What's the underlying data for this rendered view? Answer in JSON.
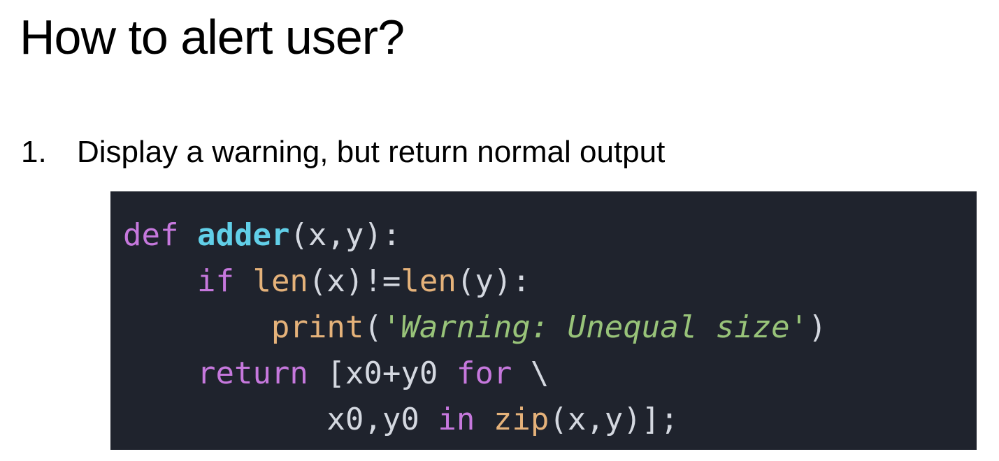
{
  "slide": {
    "title": "How to alert user?",
    "list": {
      "number": "1.",
      "text": "Display a warning, but return normal output"
    }
  },
  "code": {
    "language": "python",
    "colors": {
      "background": "#1f232d",
      "keyword": "#c678dd",
      "function_name": "#61cfe8",
      "builtin": "#e5b27a",
      "string": "#98c379",
      "plain": "#d4d8e0"
    },
    "lines": [
      {
        "indent": "",
        "tokens": [
          {
            "t": "def",
            "k": "kw"
          },
          {
            "t": " ",
            "k": "plain"
          },
          {
            "t": "adder",
            "k": "fn"
          },
          {
            "t": "(x,y):",
            "k": "plain"
          }
        ]
      },
      {
        "indent": "    ",
        "tokens": [
          {
            "t": "if",
            "k": "kw"
          },
          {
            "t": " ",
            "k": "plain"
          },
          {
            "t": "len",
            "k": "builtin"
          },
          {
            "t": "(x)!=",
            "k": "plain"
          },
          {
            "t": "len",
            "k": "builtin"
          },
          {
            "t": "(y):",
            "k": "plain"
          }
        ]
      },
      {
        "indent": "        ",
        "tokens": [
          {
            "t": "print",
            "k": "builtin"
          },
          {
            "t": "(",
            "k": "plain"
          },
          {
            "t": "'Warning: Unequal size'",
            "k": "str"
          },
          {
            "t": ")",
            "k": "plain"
          }
        ]
      },
      {
        "indent": "    ",
        "tokens": [
          {
            "t": "return",
            "k": "kw"
          },
          {
            "t": " [x0+y0 ",
            "k": "plain"
          },
          {
            "t": "for",
            "k": "kw"
          },
          {
            "t": " \\",
            "k": "plain"
          }
        ]
      },
      {
        "indent": "           ",
        "tokens": [
          {
            "t": "x0,y0 ",
            "k": "plain"
          },
          {
            "t": "in",
            "k": "kw"
          },
          {
            "t": " ",
            "k": "plain"
          },
          {
            "t": "zip",
            "k": "builtin"
          },
          {
            "t": "(x,y)];",
            "k": "plain"
          }
        ]
      }
    ]
  }
}
